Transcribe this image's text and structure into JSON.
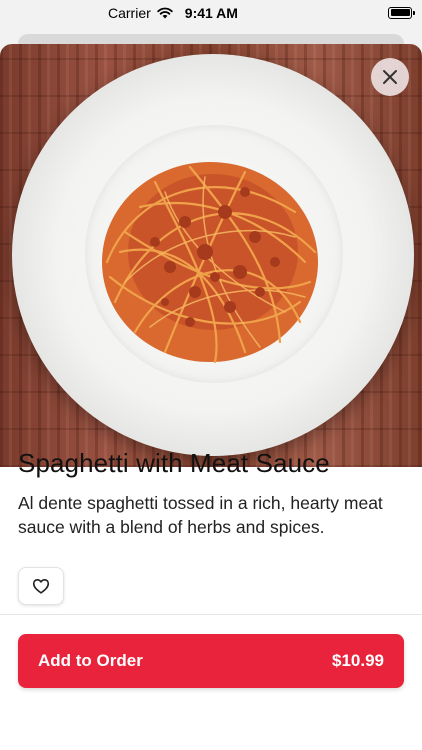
{
  "status_bar": {
    "carrier": "Carrier",
    "time": "9:41 AM"
  },
  "item": {
    "title": "Spaghetti with Meat Sauce",
    "description": "Al dente spaghetti tossed in a rich, hearty meat sauce with a blend of herbs and spices."
  },
  "actions": {
    "close_icon": "close-icon",
    "favorite_icon": "heart-icon",
    "add_to_order_label": "Add to Order",
    "price": "$10.99"
  },
  "colors": {
    "accent": "#e8233b",
    "background": "#f2f2f2"
  }
}
